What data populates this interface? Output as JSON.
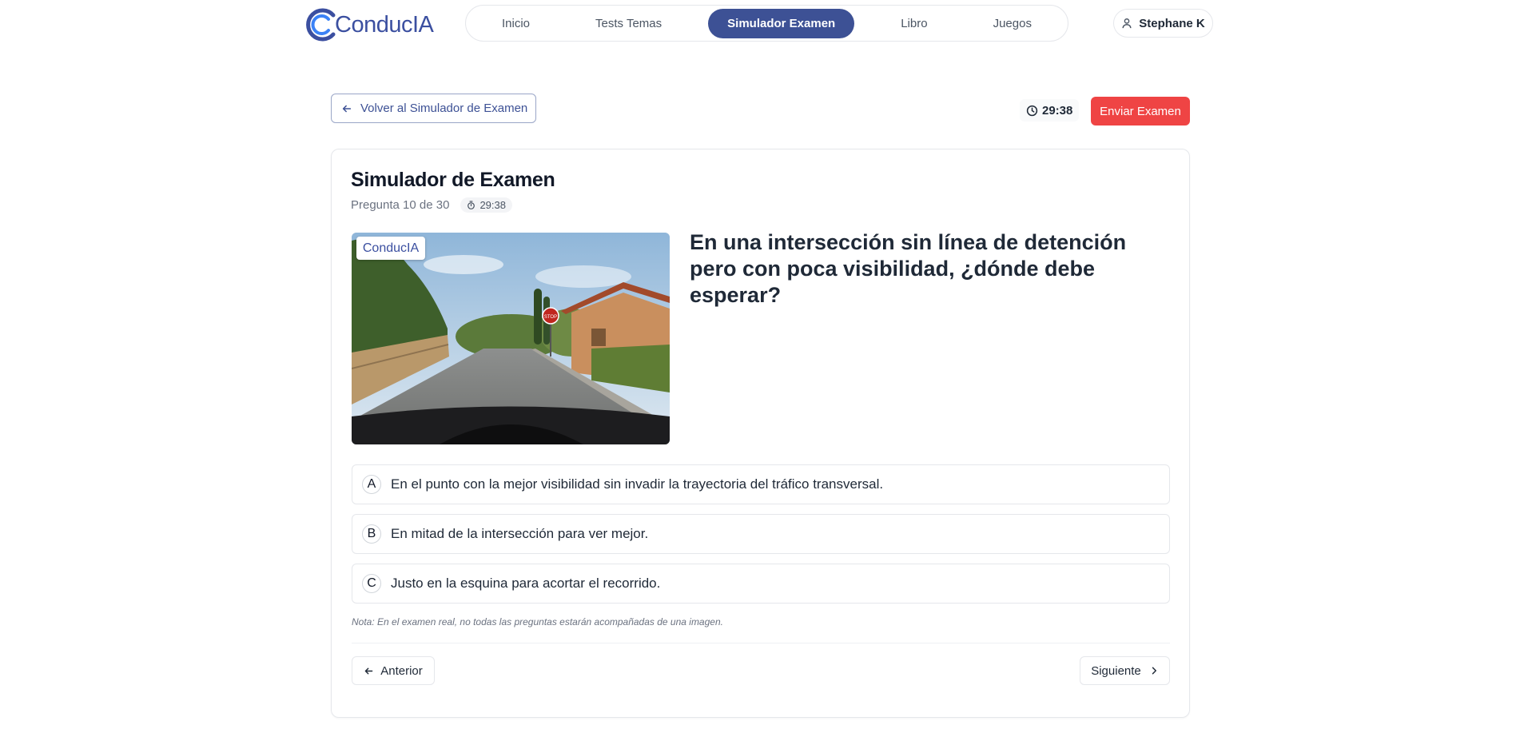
{
  "brand": {
    "name": "ConducIA",
    "logo_icon": "conducia-logo-icon",
    "accent": "#3d5195"
  },
  "nav": {
    "items": [
      {
        "label": "Inicio",
        "active": false
      },
      {
        "label": "Tests Temas",
        "active": false
      },
      {
        "label": "Simulador Examen",
        "active": true
      },
      {
        "label": "Libro",
        "active": false
      },
      {
        "label": "Juegos",
        "active": false
      }
    ]
  },
  "user": {
    "name": "Stephane K",
    "icon": "user-icon"
  },
  "toolbar": {
    "back_label": "Volver al Simulador de Examen",
    "timer": "29:38",
    "submit_label": "Enviar Examen",
    "submit_color": "#ef4444"
  },
  "exam": {
    "title": "Simulador de Examen",
    "progress": "Pregunta 10 de 30",
    "timer": "29:38",
    "image_watermark": "ConducIA",
    "question": "En una intersección sin línea de detención pero con poca visibilidad, ¿dónde debe esperar?",
    "options": [
      {
        "letter": "A",
        "text": "En el punto con la mejor visibilidad sin invadir la trayectoria del tráfico transversal."
      },
      {
        "letter": "B",
        "text": "En mitad de la intersección para ver mejor."
      },
      {
        "letter": "C",
        "text": "Justo en la esquina para acortar el recorrido."
      }
    ],
    "note": "Nota: En el examen real, no todas las preguntas estarán acompañadas de una imagen.",
    "prev_label": "Anterior",
    "next_label": "Siguiente"
  }
}
